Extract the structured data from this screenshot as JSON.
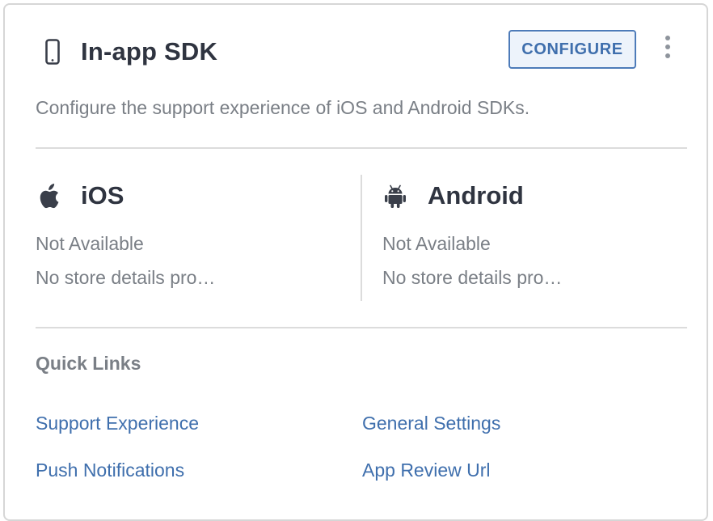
{
  "card": {
    "icon": "mobile-phone-icon",
    "title": "In-app SDK",
    "configure_label": "CONFIGURE",
    "more_icon": "vertical-ellipsis-icon",
    "description": "Configure the support experience of iOS and Android SDKs."
  },
  "platforms": {
    "ios": {
      "icon": "apple-icon",
      "name": "iOS",
      "status": "Not Available",
      "store": "No store details pro…"
    },
    "android": {
      "icon": "android-icon",
      "name": "Android",
      "status": "Not Available",
      "store": "No store details pro…"
    }
  },
  "quick_links": {
    "title": "Quick Links",
    "items": [
      {
        "label": "Support Experience"
      },
      {
        "label": "General Settings"
      },
      {
        "label": "Push Notifications"
      },
      {
        "label": "App Review Url"
      }
    ]
  },
  "colors": {
    "title_text": "#2f3440",
    "muted_text": "#7a7f86",
    "link": "#3f6fad",
    "button_border": "#4d7bb9",
    "button_bg": "#edf3fb",
    "divider": "#dcdcdc"
  }
}
